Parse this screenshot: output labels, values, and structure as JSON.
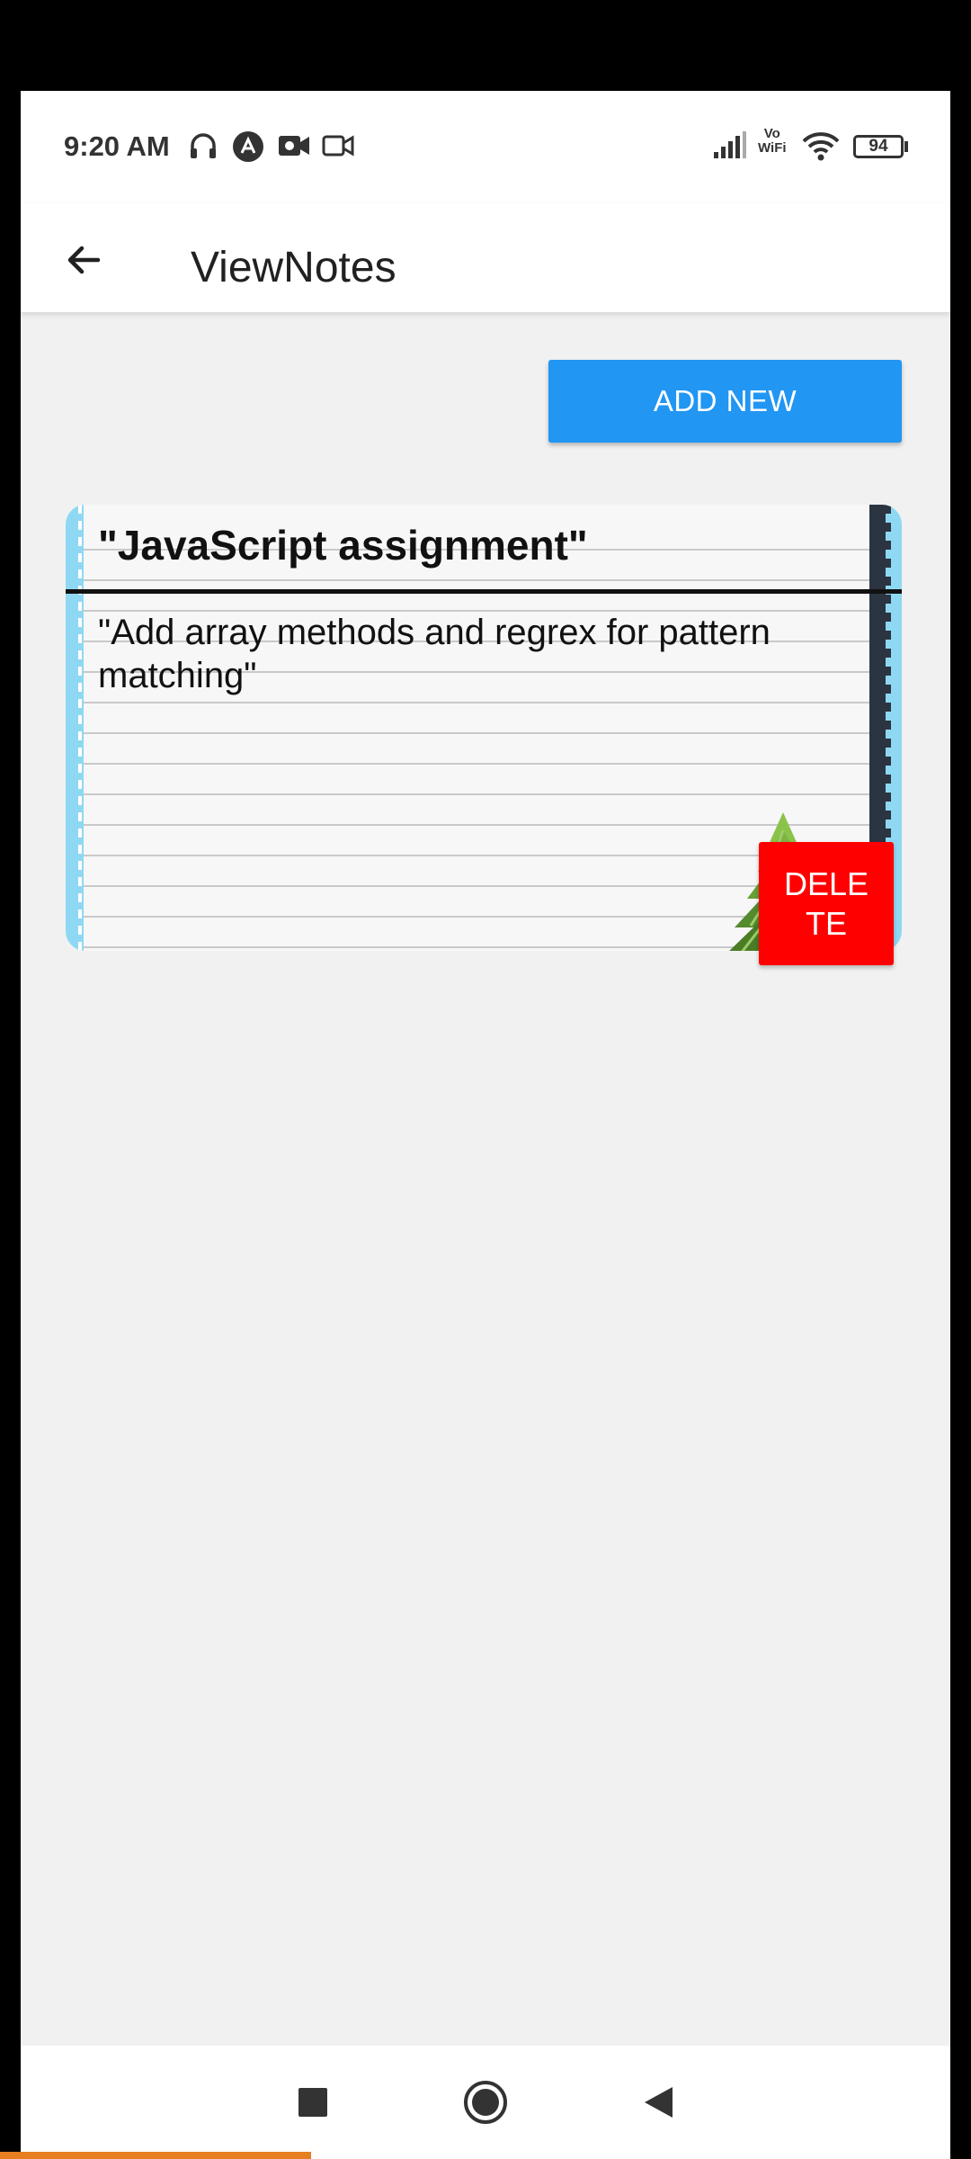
{
  "status_bar": {
    "time": "9:20 AM",
    "left_icons": [
      "headphones-icon",
      "app-notification-icon",
      "video-record-icon",
      "screen-record-icon"
    ],
    "right_icons": [
      "signal-icon",
      "vowifi-icon",
      "wifi-icon",
      "battery-icon"
    ],
    "vowifi_text": [
      "Vo",
      "WiFi"
    ],
    "battery": "94"
  },
  "app_bar": {
    "title": "ViewNotes"
  },
  "actions": {
    "add_new_label": "ADD NEW"
  },
  "notes": [
    {
      "title": "\"JavaScript assignment\"",
      "body": "\"Add array methods and regrex for pattern matching\"",
      "delete_label": "DELETE"
    }
  ],
  "colors": {
    "primary": "#2196f3",
    "danger": "#ff0000",
    "background": "#f1f1f1",
    "note_edge": "#8fd8f3"
  },
  "nav_bar": {
    "items": [
      "recents-square-icon",
      "home-circle-icon",
      "back-triangle-icon"
    ]
  }
}
